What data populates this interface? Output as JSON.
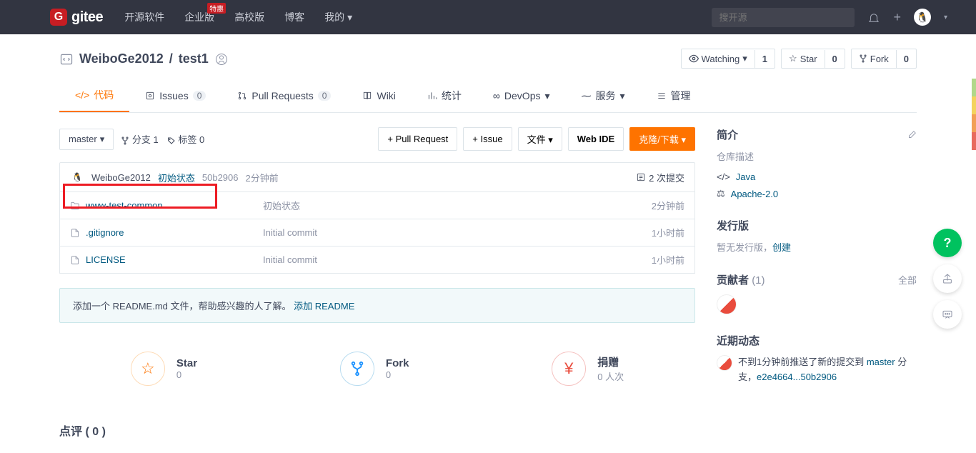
{
  "nav": {
    "logo_text": "gitee",
    "links": [
      "开源软件",
      "企业版",
      "高校版",
      "博客",
      "我的"
    ],
    "special_badge": "特惠",
    "search_placeholder": "搜开源"
  },
  "repo": {
    "owner": "WeiboGe2012",
    "name": "test1"
  },
  "actions": {
    "watching": {
      "label": "Watching",
      "count": "1"
    },
    "star": {
      "label": "Star",
      "count": "0"
    },
    "fork": {
      "label": "Fork",
      "count": "0"
    }
  },
  "tabs": {
    "code": "代码",
    "issues": {
      "label": "Issues",
      "count": "0"
    },
    "pr": {
      "label": "Pull Requests",
      "count": "0"
    },
    "wiki": "Wiki",
    "stats": "统计",
    "devops": "DevOps",
    "service": "服务",
    "manage": "管理"
  },
  "toolbar": {
    "branch": "master",
    "branches": "分支 1",
    "tags": "标签 0",
    "pull_request": "+ Pull Request",
    "issue": "+ Issue",
    "file": "文件",
    "web_ide": "Web IDE",
    "clone": "克隆/下载"
  },
  "commit": {
    "author": "WeiboGe2012",
    "message": "初始状态",
    "sha": "50b2906",
    "time": "2分钟前",
    "count_label": "2 次提交"
  },
  "files": [
    {
      "name": "www-test-common",
      "type": "folder",
      "message": "初始状态",
      "time": "2分钟前",
      "highlight": true
    },
    {
      "name": ".gitignore",
      "type": "file",
      "message": "Initial commit",
      "time": "1小时前"
    },
    {
      "name": "LICENSE",
      "type": "file",
      "message": "Initial commit",
      "time": "1小时前"
    }
  ],
  "readme": {
    "text": "添加一个 README.md 文件，帮助感兴趣的人了解。",
    "link": "添加 README"
  },
  "stats": {
    "star": {
      "label": "Star",
      "count": "0"
    },
    "fork": {
      "label": "Fork",
      "count": "0"
    },
    "donate": {
      "label": "捐赠",
      "count": "0 人次"
    }
  },
  "comments_title": "点评 ( 0 )",
  "sidebar": {
    "intro": {
      "title": "简介",
      "desc": "仓库描述"
    },
    "language": "Java",
    "license": "Apache-2.0",
    "releases": {
      "title": "发行版",
      "empty": "暂无发行版，",
      "create": "创建"
    },
    "contributors": {
      "title": "贡献者",
      "count": "(1)",
      "all": "全部"
    },
    "activity": {
      "title": "近期动态",
      "text_before": "不到1分钟前推送了新的提交到 ",
      "branch": "master",
      "text_mid": " 分支，",
      "sha": "e2e4664...50b2906"
    }
  }
}
